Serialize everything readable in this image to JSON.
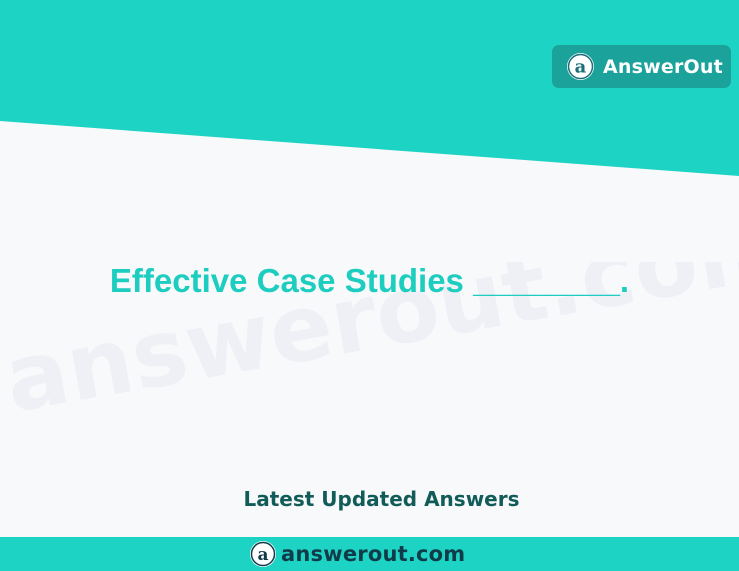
{
  "brand": {
    "badge_name": "AnswerOut",
    "logo_letter": "a",
    "badge_color": "#1aa29b"
  },
  "headline": {
    "text": "Effective Case Studies ________."
  },
  "watermark": {
    "text": "answerout.com"
  },
  "tagline": {
    "text": "Latest Updated Answers"
  },
  "footer": {
    "domain": "answerout.com",
    "logo_letter": "a"
  },
  "colors": {
    "teal": "#1dd3c3",
    "headline": "#1dcdbf",
    "tagline": "#115c59",
    "background": "#f8f9fb"
  }
}
